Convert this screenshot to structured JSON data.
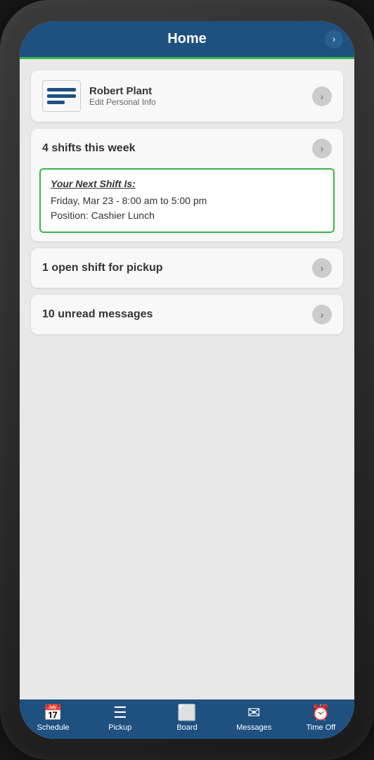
{
  "header": {
    "title": "Home",
    "arrow": "›"
  },
  "profile": {
    "name": "Robert Plant",
    "sub_label": "Edit Personal Info",
    "arrow": "›"
  },
  "shifts": {
    "summary": "4 shifts this week",
    "next_shift_label": "Your Next Shift Is:",
    "next_shift_date": "Friday, Mar 23 - 8:00 am to 5:00 pm",
    "next_shift_position": "Position: Cashier Lunch",
    "arrow": "›"
  },
  "open_shift": {
    "text": "1 open shift for pickup",
    "arrow": "›"
  },
  "messages": {
    "text": "10 unread messages",
    "arrow": "›"
  },
  "bottom_nav": [
    {
      "id": "schedule",
      "label": "Schedule",
      "icon": "📅"
    },
    {
      "id": "pickup",
      "label": "Pickup",
      "icon": "☰"
    },
    {
      "id": "board",
      "label": "Board",
      "icon": "⬜"
    },
    {
      "id": "messages",
      "label": "Messages",
      "icon": "✉"
    },
    {
      "id": "timeoff",
      "label": "Time Off",
      "icon": "⏰"
    }
  ]
}
